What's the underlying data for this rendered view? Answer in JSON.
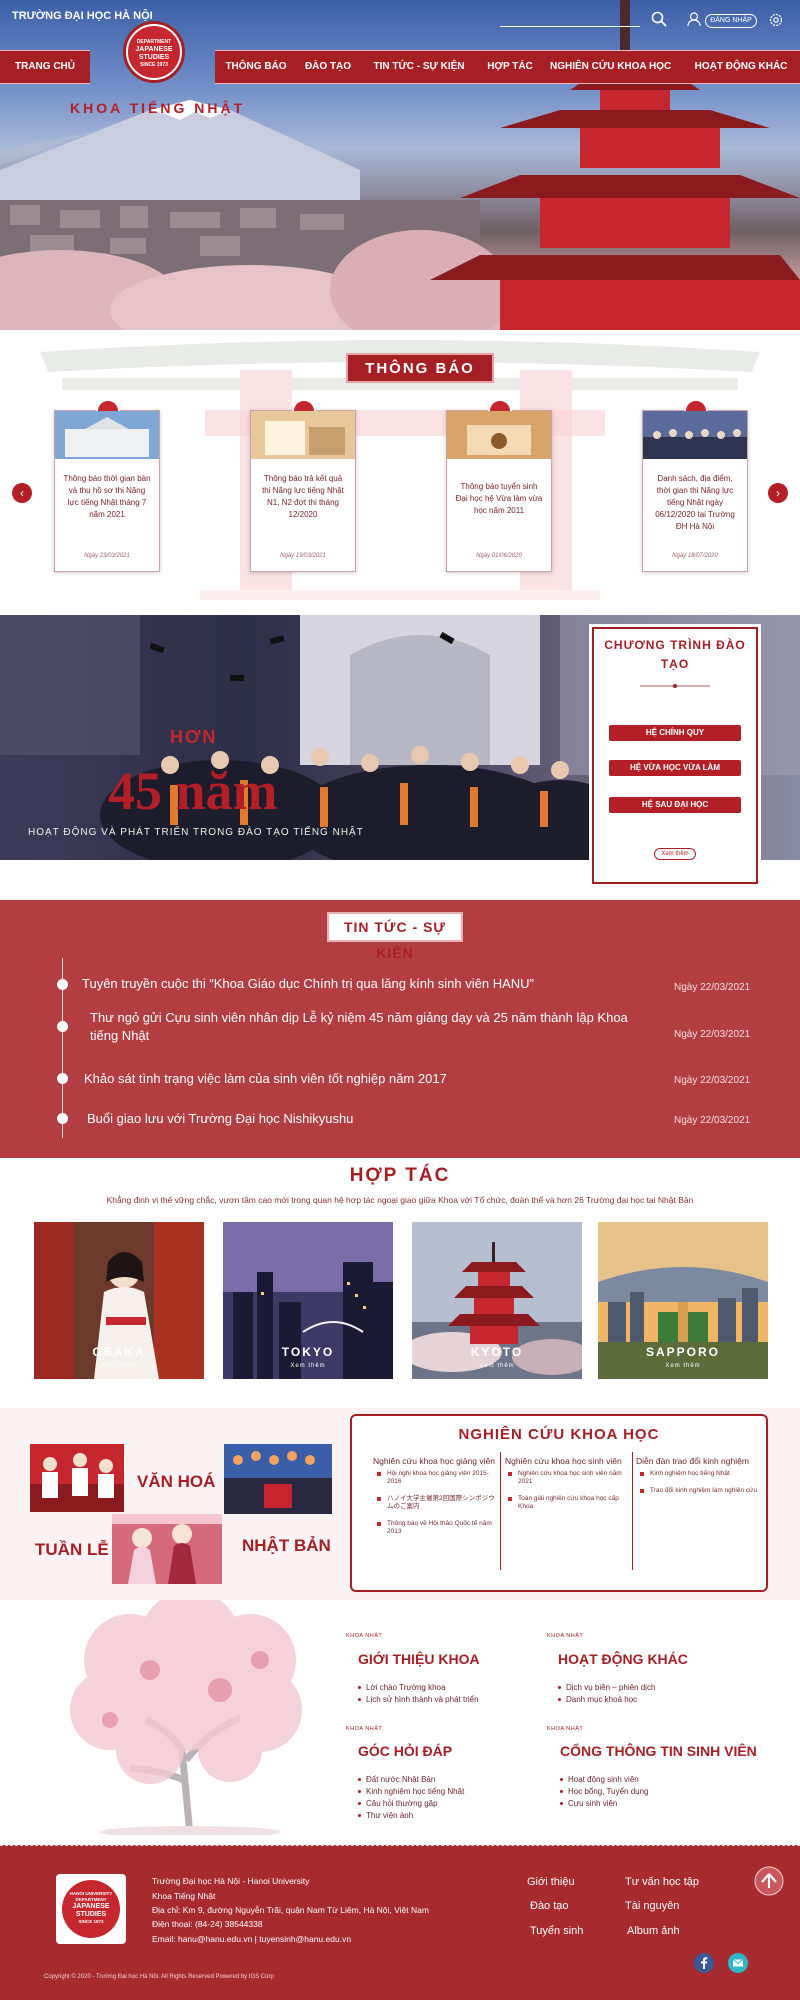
{
  "header": {
    "university": "TRƯỜNG ĐẠI HỌC HÀ NỘI",
    "login": "ĐĂNG NHẬP",
    "logo_text": [
      "DEPARTMENT",
      "JAPANESE",
      "STUDIES",
      "SINCE 1973"
    ],
    "dept_title": "KHOA TIẾNG NHẬT",
    "nav": [
      "TRANG CHỦ",
      "THÔNG BÁO",
      "ĐÀO TẠO",
      "TIN TỨC - SỰ KIỆN",
      "HỢP TÁC",
      "NGHIÊN CỨU KHOA HỌC",
      "HOẠT ĐỘNG KHÁC"
    ]
  },
  "announcements": {
    "title": "THÔNG BÁO",
    "cards": [
      {
        "text": "Thông báo thời gian bàn và thu hồ sơ thi Năng lực tiếng Nhật tháng 7 năm 2021",
        "date": "Ngày 23/03/2021"
      },
      {
        "text": "Thông báo trả kết quả thi Năng lực tiếng Nhật N1, N2 đợt thi tháng 12/2020",
        "date": "Ngày 19/03/2021"
      },
      {
        "text": "Thông báo tuyển sinh Đại học hệ Vừa làm vừa học năm 2011",
        "date": "Ngày 01/06/2020"
      },
      {
        "text": "Danh sách, địa điểm, thời gian thi Năng lực tiếng Nhật ngày 06/12/2020 tại Trường ĐH Hà Nội",
        "date": "Ngày 18/07/2020"
      }
    ]
  },
  "training": {
    "hon": "HƠN",
    "years": "45 năm",
    "activity": "HOẠT ĐỘNG VÀ PHÁT TRIỂN TRONG ĐÀO TẠO TIẾNG NHẬT",
    "program_title": "CHƯƠNG TRÌNH ĐÀO TẠO",
    "buttons": [
      "HỆ CHÍNH QUY",
      "HỆ VỪA HỌC VỪA LÀM",
      "HỆ SAU ĐẠI HỌC"
    ],
    "more": "Xem thêm"
  },
  "news": {
    "title": "TIN TỨC - SỰ KIỆN",
    "items": [
      {
        "text": "Tuyên truyền cuộc thi “Khoa Giáo dục Chính trị qua lăng kính sinh viên HANU”",
        "date": "Ngày 22/03/2021"
      },
      {
        "text": "Thư ngỏ gửi Cựu sinh viên nhân dịp Lễ kỷ niệm 45 năm giảng dạy và 25 năm thành lập Khoa tiếng Nhật",
        "date": "Ngày 22/03/2021"
      },
      {
        "text": "Khảo sát tình trạng việc làm của sinh viên tốt nghiệp năm 2017",
        "date": "Ngày 22/03/2021"
      },
      {
        "text": "Buổi giao lưu với Trường Đại học Nishikyushu",
        "date": "Ngày 22/03/2021"
      }
    ]
  },
  "cooperation": {
    "title": "HỢP TÁC",
    "subtitle": "Khẳng định vị thế vững chắc, vươn tầm cao mới trong quan hệ hợp tác ngoại giao giữa Khoa với Tổ chức, đoàn thể và hơn 26 Trường đại học tại Nhật Bản",
    "more": "Xem thêm",
    "cities": [
      "OSAKA",
      "TOKYO",
      "KYOTO",
      "SAPPORO"
    ]
  },
  "culture": {
    "words": [
      "VĂN HOÁ",
      "TUẦN LỄ",
      "NHẬT BẢN"
    ]
  },
  "research": {
    "title": "NGHIÊN CỨU KHOA HỌC",
    "columns": [
      {
        "heading": "Nghiên cứu khoa học giảng viên",
        "items": [
          "Hội nghị khoa học giảng viên 2015-2016",
          "ハノイ大学主催第2回国際シンポジウムのご案内",
          "Thông báo về Hội thảo Quốc tế năm 2013"
        ]
      },
      {
        "heading": "Nghiên cứu khoa học sinh viên",
        "items": [
          "Nghiên cứu khoa học sinh viên năm 2021",
          "Toàn giải nghiên cứu khoa học cấp Khoa"
        ]
      },
      {
        "heading": "Diễn đàn trao đổi kinh nghiệm",
        "items": [
          "Kinh nghiệm học tiếng Nhật",
          "Trao đổi kinh nghiệm làm nghiên cứu"
        ]
      }
    ]
  },
  "links": {
    "caption": "KHOA NHẬT",
    "blocks": [
      {
        "title": "GIỚI THIỆU KHOA",
        "items": [
          "Lời chào Trường khoa",
          "Lịch sử hình thành và phát triển"
        ]
      },
      {
        "title": "HOẠT ĐỘNG KHÁC",
        "items": [
          "Dịch vụ biên – phiên dịch",
          "Danh mục khoá học"
        ]
      },
      {
        "title": "GÓC HỎI ĐÁP",
        "items": [
          "Đất nước Nhật Bản",
          "Kinh nghiệm học tiếng Nhật",
          "Câu hỏi thường gặp",
          "Thư viện ảnh"
        ]
      },
      {
        "title": "CỔNG THÔNG TIN SINH VIÊN",
        "items": [
          "Hoạt động sinh viên",
          "Học bổng, Tuyển dụng",
          "Cựu sinh viên"
        ]
      }
    ]
  },
  "footer": {
    "lines": [
      "Trường Đại học Hà Nội - Hanoi University",
      "Khoa Tiếng Nhật",
      "Địa chỉ: Km 9, đường Nguyễn Trãi, quận Nam Từ Liêm, Hà Nội, Việt Nam",
      "Điện thoại: (84-24) 38544338",
      "Email: hanu@hanu.edu.vn | tuyensinh@hanu.edu.vn"
    ],
    "links": [
      "Giới thiệu",
      "Đào tạo",
      "Tuyển sinh",
      "Tư vấn học tập",
      "Tài nguyên",
      "Album ảnh"
    ],
    "copyright": "Copyright © 2020 - Trường Đại học Hà Nội. All Rights Reserved Powered by IGS Corp",
    "logo_text": [
      "HANOI UNIVERSITY",
      "DEPARTMENT",
      "JAPANESE",
      "STUDIES",
      "SINCE 1973"
    ]
  },
  "colors": {
    "brand": "#a61f24",
    "accent": "#c6262e"
  }
}
